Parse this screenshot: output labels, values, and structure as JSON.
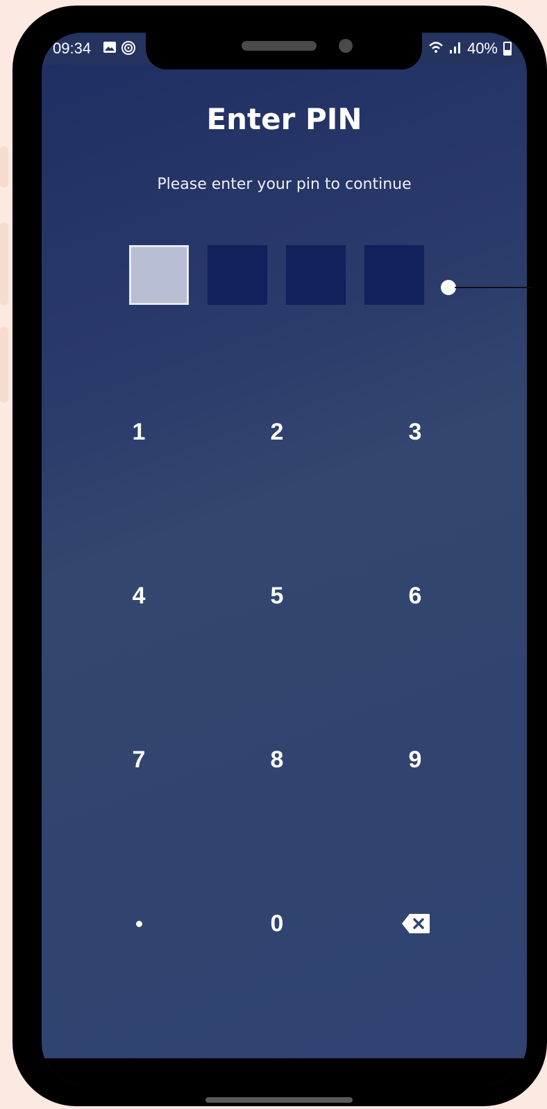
{
  "status_bar": {
    "time": "09:34",
    "battery": "40%",
    "icons_left": [
      "gallery-icon",
      "fingerprint-icon"
    ],
    "icons_right": [
      "wifi-call-icon",
      "signal-icon",
      "battery-icon"
    ]
  },
  "header": {
    "title": "Enter PIN",
    "subtitle": "Please enter your pin to continue"
  },
  "pin": {
    "length": 4,
    "filled": 0,
    "active_index": 0
  },
  "keypad": {
    "keys": [
      "1",
      "2",
      "3",
      "4",
      "5",
      "6",
      "7",
      "8",
      "9",
      "•",
      "0",
      "backspace"
    ]
  },
  "colors": {
    "background_top": "#1f2e62",
    "background_bottom": "#304373",
    "pin_box": "#10215c",
    "pin_box_active": "#b8bed3",
    "text": "#ffffff"
  }
}
